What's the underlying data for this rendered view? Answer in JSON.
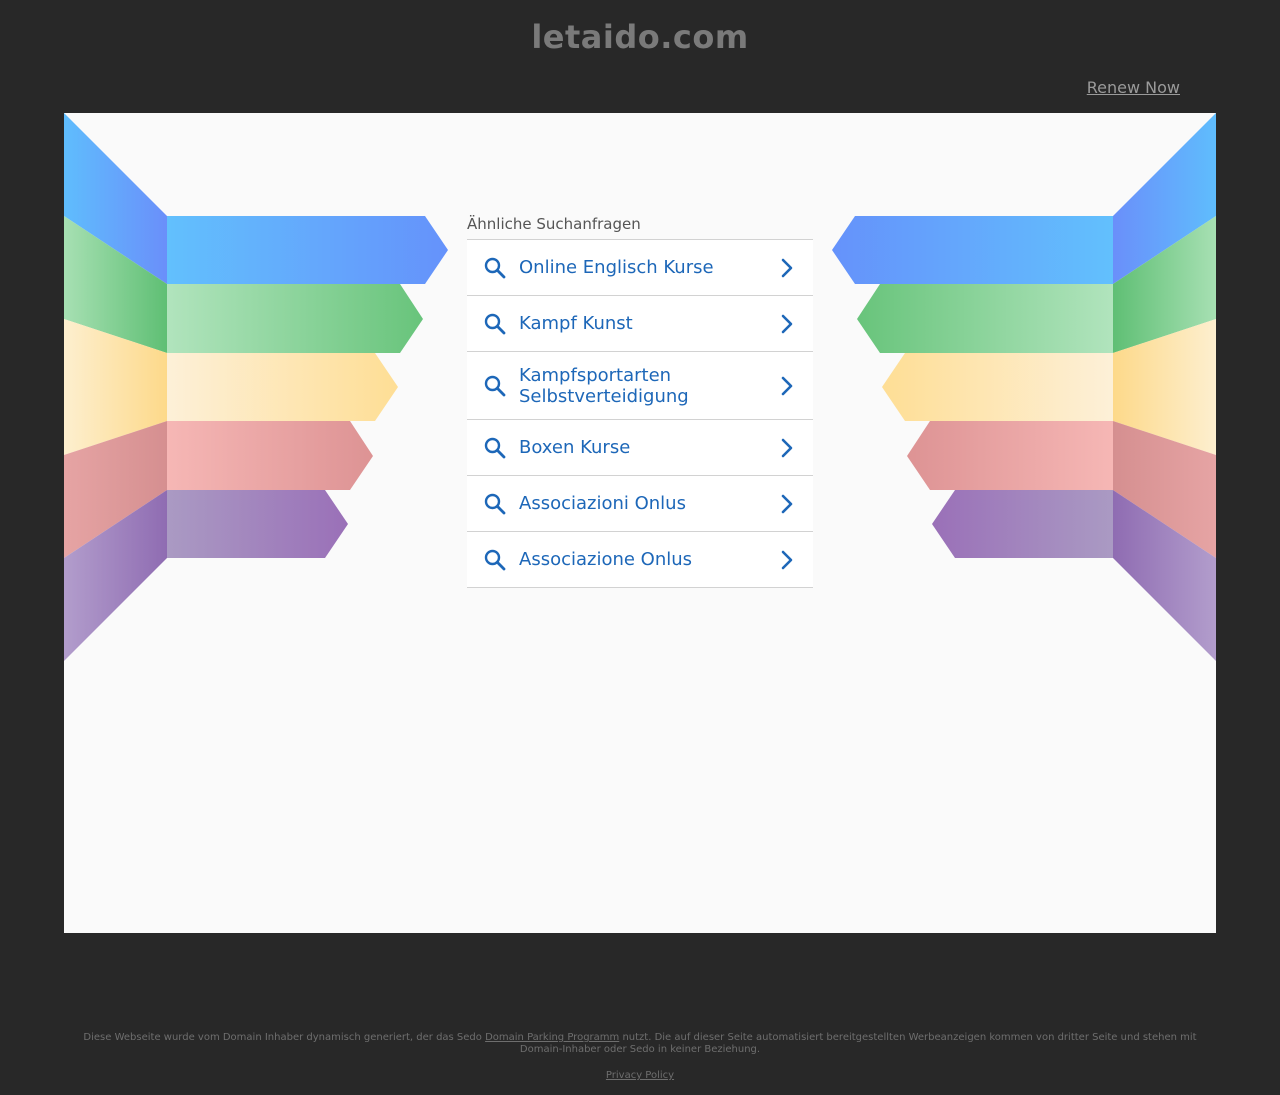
{
  "header": {
    "site_title": "letaido.com",
    "renew_label": "Renew Now"
  },
  "searches": {
    "heading": "Ähnliche Suchanfragen",
    "items": [
      {
        "label": "Online Englisch Kurse"
      },
      {
        "label": "Kampf Kunst"
      },
      {
        "label": "Kampfsportarten Selbstverteidigung"
      },
      {
        "label": "Boxen Kurse"
      },
      {
        "label": "Associazioni Onlus"
      },
      {
        "label": "Associazione Onlus"
      }
    ],
    "icons": {
      "leading": "search-icon",
      "trailing": "chevron-right-icon"
    }
  },
  "footer": {
    "text_before": "Diese Webseite wurde vom Domain Inhaber dynamisch generiert, der das Sedo ",
    "link_label": "Domain Parking Programm",
    "text_after": " nutzt. Die auf dieser Seite automatisiert bereitgestellten Werbeanzeigen kommen von dritter Seite und stehen mit Domain-Inhaber oder Sedo in keiner Beziehung.",
    "privacy_label": "Privacy Policy"
  },
  "colors": {
    "background": "#282828",
    "panel": "#fafafa",
    "link_blue": "#1d67b8",
    "ribbon_blue": "#64bcfc",
    "ribbon_green": "#6cc47c",
    "ribbon_yellow": "#fde094",
    "ribbon_red": "#f4b4b4",
    "ribbon_purple": "#9c74b8"
  }
}
